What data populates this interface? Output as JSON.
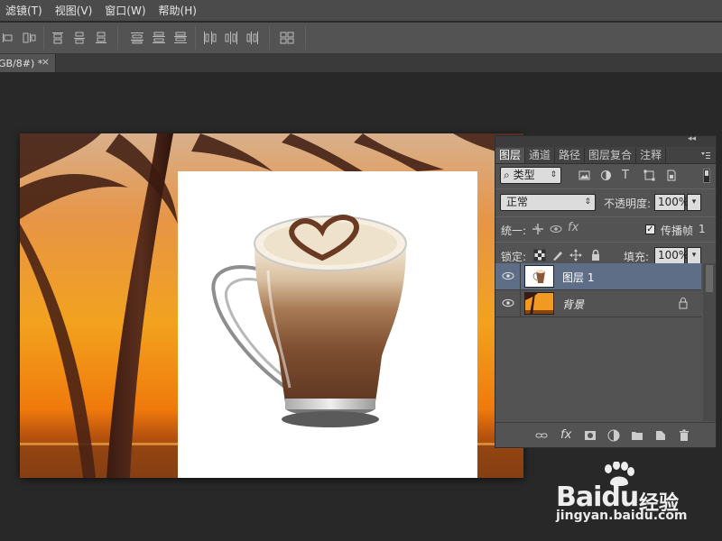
{
  "menubar": {
    "items": [
      "滤镜(T)",
      "视图(V)",
      "窗口(W)",
      "帮助(H)"
    ]
  },
  "optionsbar": {
    "align_icons": [
      "align-left-edges-icon",
      "align-horizontal-centers-icon",
      "align-top-edges-icon",
      "align-vertical-centers-icon",
      "align-bottom-edges-icon",
      "distribute-top-icon",
      "distribute-vcenter-icon",
      "distribute-bottom-icon",
      "distribute-left-icon",
      "distribute-hcenter-icon",
      "distribute-right-icon",
      "auto-align-icon"
    ]
  },
  "document_tab": {
    "label": "GB/8#) *",
    "close": "×"
  },
  "layers_panel": {
    "collapse_glyph": "◂◂",
    "tabs": [
      "图层",
      "通道",
      "路径",
      "图层复合",
      "注释"
    ],
    "active_tab": "图层",
    "filter": {
      "label": "类型",
      "arrow": "⇕",
      "search_glyph": "⌕"
    },
    "filter_icons": [
      "pixel-filter-icon",
      "adjustment-filter-icon",
      "type-filter-icon",
      "shape-filter-icon",
      "smart-object-filter-icon"
    ],
    "type_filter_glyph": "T",
    "blend_mode": {
      "value": "正常",
      "arrow": "⇕"
    },
    "opacity": {
      "label": "不透明度:",
      "value": "100%",
      "arrow": "▾"
    },
    "unify": {
      "label": "统一:",
      "propagate_label": "传播帧",
      "propagate_checked": true,
      "check_glyph": "✓",
      "frame_number": "1"
    },
    "lock": {
      "label": "锁定:"
    },
    "fill": {
      "label": "填充:",
      "value": "100%",
      "arrow": "▾"
    },
    "layers": [
      {
        "name": "图层 1",
        "selected": true,
        "visible": true,
        "locked": false
      },
      {
        "name": "背景",
        "selected": false,
        "visible": true,
        "locked": true
      }
    ],
    "footer_icons": [
      "link-layers-icon",
      "fx-icon",
      "add-mask-icon",
      "new-adjustment-icon",
      "new-group-icon",
      "new-layer-icon",
      "delete-layer-icon"
    ],
    "fx_glyph": "fx"
  },
  "watermark": {
    "brand_left": "Bai",
    "brand_mid": "du",
    "brand_right": "经验",
    "url": "jingyan.baidu.com"
  },
  "colors": {
    "app_bg": "#282828",
    "panel_bg": "#535353",
    "selection": "#5d6e86"
  }
}
